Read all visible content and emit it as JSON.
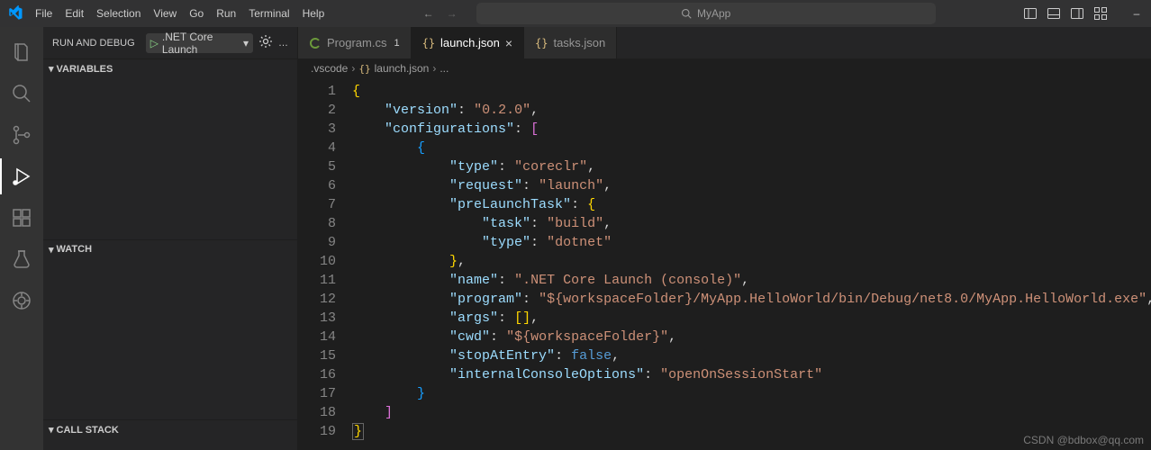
{
  "menu": {
    "file": "File",
    "edit": "Edit",
    "selection": "Selection",
    "view": "View",
    "go": "Go",
    "run": "Run",
    "terminal": "Terminal",
    "help": "Help"
  },
  "search": {
    "placeholder": "MyApp"
  },
  "activity": {
    "explorer": "explorer",
    "search": "search",
    "scm": "source-control",
    "debug": "run-and-debug",
    "extensions": "extensions",
    "testing": "testing",
    "remote": "remote"
  },
  "runDebug": {
    "title": "RUN AND DEBUG",
    "config": ".NET Core Launch",
    "sections": {
      "variables": "VARIABLES",
      "watch": "WATCH",
      "callstack": "CALL STACK"
    }
  },
  "tabs": [
    {
      "icon": "cs",
      "label": "Program.cs",
      "dirty": "1",
      "active": false
    },
    {
      "icon": "json",
      "label": "launch.json",
      "close": true,
      "active": true
    },
    {
      "icon": "json",
      "label": "tasks.json",
      "active": false
    }
  ],
  "breadcrumb": {
    "folder": ".vscode",
    "file": "launch.json",
    "more": "..."
  },
  "code": {
    "lines": [
      "{",
      "    \"version\": \"0.2.0\",",
      "    \"configurations\": [",
      "        {",
      "            \"type\": \"coreclr\",",
      "            \"request\": \"launch\",",
      "            \"preLaunchTask\": {",
      "                \"task\": \"build\",",
      "                \"type\": \"dotnet\"",
      "            },",
      "            \"name\": \".NET Core Launch (console)\",",
      "            \"program\": \"${workspaceFolder}/MyApp.HelloWorld/bin/Debug/net8.0/MyApp.HelloWorld.exe\",",
      "            \"args\": [],",
      "            \"cwd\": \"${workspaceFolder}\",",
      "            \"stopAtEntry\": false,",
      "            \"internalConsoleOptions\": \"openOnSessionStart\"",
      "        }",
      "    ]",
      "}"
    ],
    "json": {
      "version": "0.2.0",
      "configurations": [
        {
          "type": "coreclr",
          "request": "launch",
          "preLaunchTask": {
            "task": "build",
            "type": "dotnet"
          },
          "name": ".NET Core Launch (console)",
          "program": "${workspaceFolder}/MyApp.HelloWorld/bin/Debug/net8.0/MyApp.HelloWorld.exe",
          "args": [],
          "cwd": "${workspaceFolder}",
          "stopAtEntry": false,
          "internalConsoleOptions": "openOnSessionStart"
        }
      ]
    }
  },
  "watermark": "CSDN @bdbox@qq.com"
}
